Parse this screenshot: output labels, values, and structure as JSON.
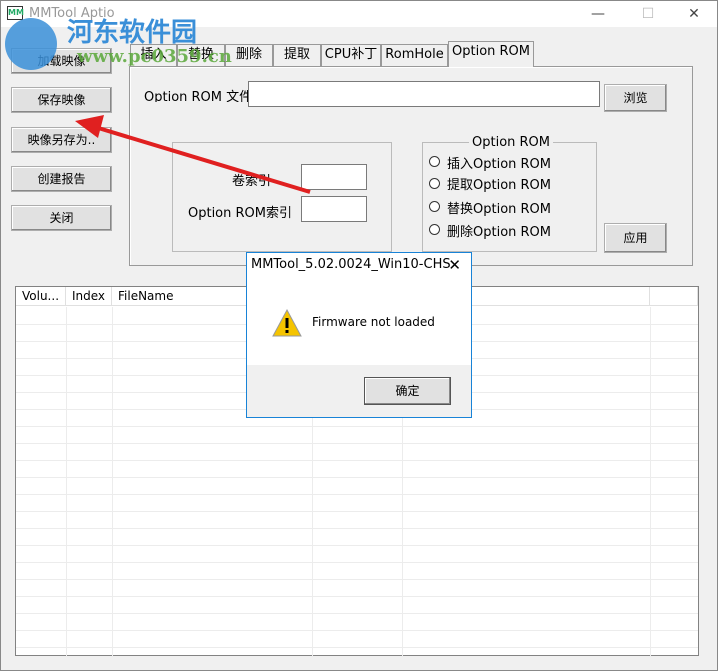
{
  "window": {
    "title": "MMTool Aptio",
    "minimize": "—",
    "maximize": "☐",
    "close": "✕"
  },
  "sidebar": {
    "load_image": "加载映像",
    "save_image": "保存映像",
    "save_as": "映像另存为..",
    "create_report": "创建报告",
    "close": "关闭"
  },
  "tabs": [
    "插入",
    "替换",
    "删除",
    "提取",
    "CPU补丁",
    "RomHole",
    "Option ROM"
  ],
  "panel": {
    "file_label": "Option ROM 文件",
    "file_value": "",
    "browse": "浏览",
    "volume_index_label": "卷索引",
    "volume_index_value": "",
    "rom_index_label": "Option ROM索引",
    "rom_index_value": "",
    "group_title": "Option ROM",
    "options": [
      "插入Option ROM",
      "提取Option ROM",
      "替换Option ROM",
      "删除Option ROM"
    ],
    "apply": "应用"
  },
  "table": {
    "columns": [
      "Volu...",
      "Index",
      "FileName",
      "",
      ""
    ]
  },
  "dialog": {
    "title": "MMTool_5.02.0024_Win10-CHS",
    "message": "Firmware not loaded",
    "ok": "确定",
    "close": "✕"
  },
  "watermark": {
    "name": "河东软件园",
    "url": "www.pc0359.cn"
  },
  "colors": {
    "arrow": "#e02020",
    "dialog_border": "#1883d7"
  }
}
